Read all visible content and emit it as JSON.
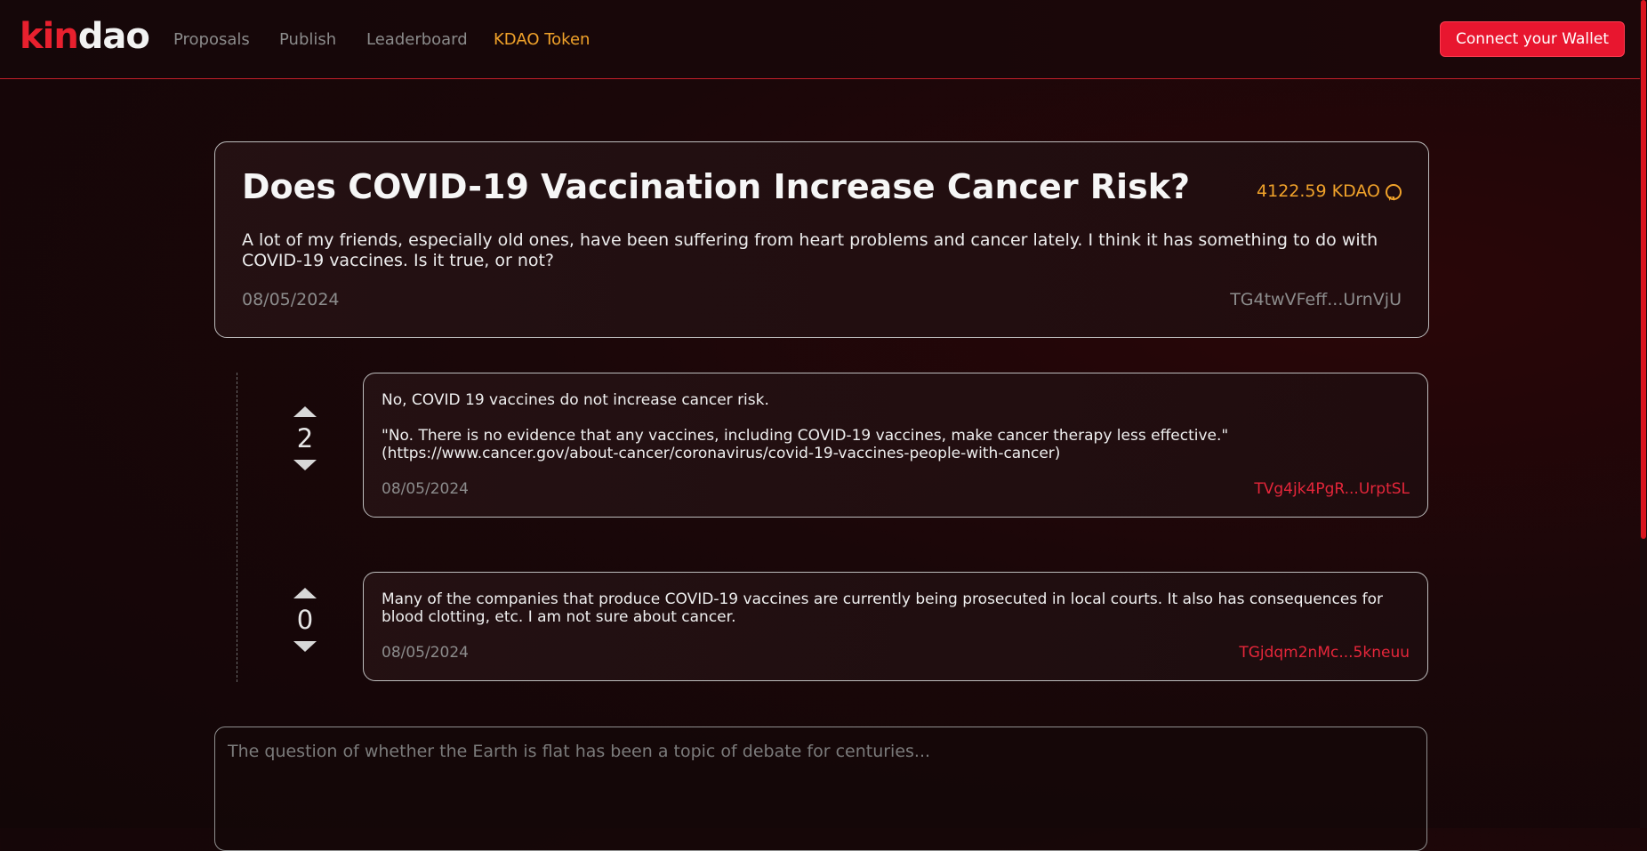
{
  "header": {
    "logo_kin": "kin",
    "logo_dao": "dao",
    "nav": [
      "Proposals",
      "Publish",
      "Leaderboard",
      "KDAO Token"
    ],
    "wallet_button": "Connect your Wallet"
  },
  "question": {
    "title": "Does COVID-19 Vaccination Increase Cancer Risk?",
    "bounty": "4122.59 KDAO",
    "body": "A lot of my friends, especially old ones, have been suffering from heart problems and cancer lately. I think it has something to do with COVID-19 vaccines. Is it true, or not?",
    "date": "08/05/2024",
    "author": "TG4twVFeff...UrnVjU"
  },
  "answers": [
    {
      "votes": "2",
      "line1": "No, COVID 19 vaccines do not increase cancer risk.",
      "line2": "\"No. There is no evidence that any vaccines, including COVID-19 vaccines, make cancer therapy less effective.\"",
      "line3": "(https://www.cancer.gov/about-cancer/coronavirus/covid-19-vaccines-people-with-cancer)",
      "date": "08/05/2024",
      "author": "TVg4jk4PgR...UrptSL"
    },
    {
      "votes": "0",
      "text": "Many of the companies that produce COVID-19 vaccines are currently being prosecuted in local courts. It also has consequences for blood clotting, etc. I am not sure about cancer.",
      "date": "08/05/2024",
      "author": "TGjdqm2nMc...5kneuu"
    }
  ],
  "reply": {
    "placeholder": "The question of whether the Earth is flat has been a topic of debate for centuries..."
  },
  "colors": {
    "accent": "#e8162f",
    "token": "#f0a22a"
  }
}
